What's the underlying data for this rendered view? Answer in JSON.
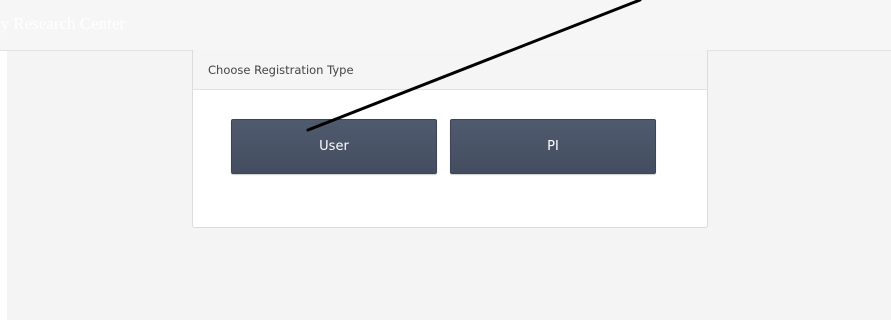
{
  "header": {
    "brand_text": "gy Research Center"
  },
  "registration": {
    "heading": "Choose Registration Type",
    "buttons": [
      {
        "label": "User"
      },
      {
        "label": "PI"
      }
    ]
  },
  "colors": {
    "button_bg": "#4a5367",
    "annotation_arrow": "#000000",
    "page_bg": "#f4f4f4"
  }
}
